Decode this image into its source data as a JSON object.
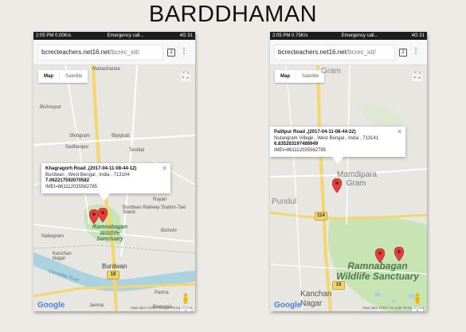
{
  "slide": {
    "title": "BARDDHAMAN"
  },
  "screens": [
    {
      "status": {
        "time": "2:05 PM",
        "speed": "0.00K/s",
        "label": "Emergency call...",
        "network": "4G",
        "battery": "31"
      },
      "url": {
        "host": "bcrecteachers.net16.net",
        "path": "/bcrec_iot/"
      },
      "tab_count": "2",
      "map_type": {
        "map_label": "Map",
        "satellite_label": "Satellite"
      },
      "info_window": {
        "title": "Khagragorh Road ,(2017-04-11-08-44-12)",
        "address": "Burdwan , West Bengal , India , 713104",
        "coords": "7.062217592070582",
        "imei": "IMEI=861112035562785"
      },
      "labels": {
        "mahachanda": "Mahachanda",
        "bishnupur": "Bishnupur",
        "shibgram": "Shibgram",
        "sadhanpur": "Sadhanpur",
        "bijoybati": "Bijoybati",
        "tentital": "Tentital",
        "nabagram": "Nabagram",
        "boinchi": "Boinchi",
        "rayan": "Rayan",
        "railway": "Burdwan Railway Station-Taxi Stand",
        "kanchannagar": "Kanchan Nagar",
        "burdwan": "Burdwan",
        "damodar": "Damodar River",
        "pamra": "Pamra",
        "jamna": "Jamna",
        "bamunia": "Bamunia",
        "sanctuary": "Ramnabagan Wildlife Sanctuary"
      },
      "road_numbers": [
        "19"
      ],
      "zoom_in": "+",
      "zoom_out": "−",
      "google": "Google",
      "attribution": "Map data ©2017 Google   Terms of Use"
    },
    {
      "status": {
        "time": "2:05 PM",
        "speed": "0.75K/s",
        "label": "Emergency call...",
        "network": "4G",
        "battery": "31"
      },
      "url": {
        "host": "bcrecteachers.net16.net",
        "path": "/bcrec_iot/"
      },
      "tab_count": "2",
      "map_type": {
        "map_label": "Map",
        "satellite_label": "Satellite"
      },
      "info_window": {
        "title": "Palitpur Road ,(2017-04-11-08-44-22)",
        "address": "Nutangram Village , West Bengal , India , 713141",
        "coords": "6.835283197486949",
        "imei": "IMEI=861112035562785"
      },
      "labels": {
        "gram": "Gram",
        "mamdipara": "Mamdipara Gram",
        "pundul": "Pundul",
        "sanctuary": "Ramnabagan Wildlife Sanctuary",
        "kanchannagar": "Kanchan Nagar",
        "bc": "BC"
      },
      "road_numbers": [
        "114",
        "19"
      ],
      "zoom_in": "+",
      "zoom_out": "−",
      "google": "Google",
      "attribution": "Map data ©2017 Google   Terms of Use"
    }
  ],
  "colors": {
    "pin": "#e2403a",
    "park": "#c9e4b4",
    "road_yellow": "#f6d66a",
    "water": "#aad3df"
  },
  "icons": [
    "tabs-icon",
    "menu-dots-icon",
    "fullscreen-icon",
    "pegman-icon",
    "map-pin-icon",
    "close-icon",
    "google-logo"
  ]
}
